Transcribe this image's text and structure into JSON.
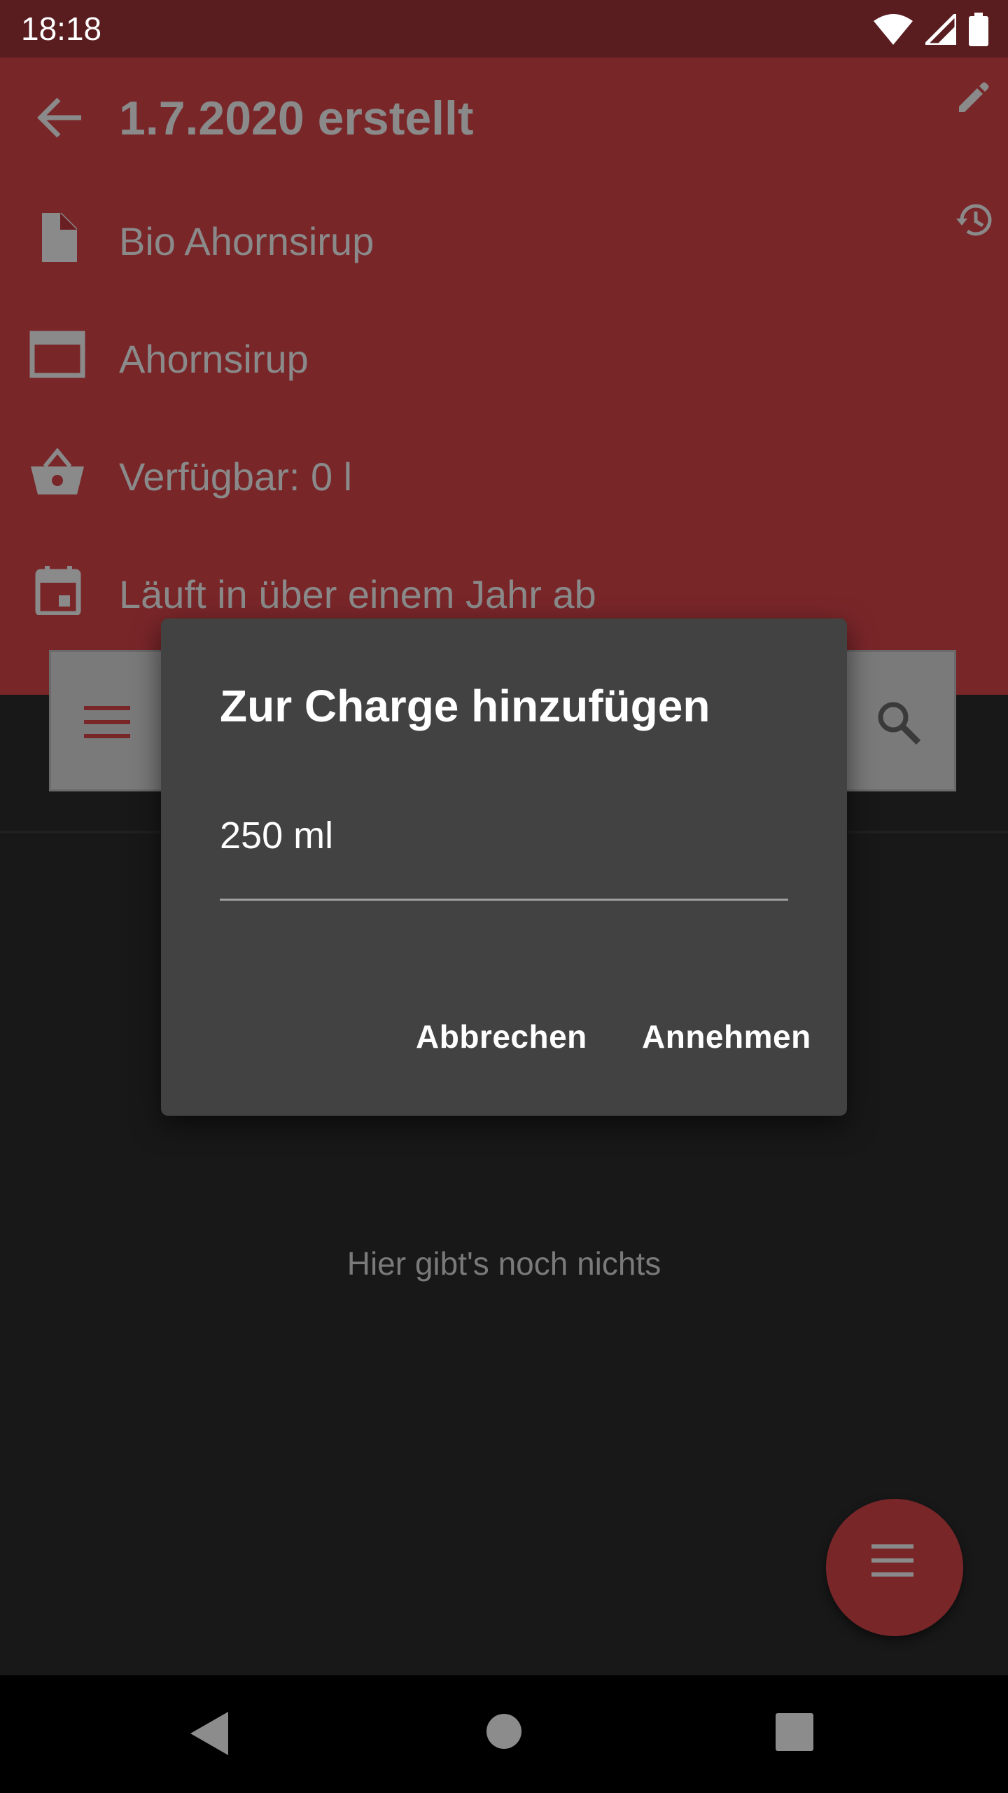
{
  "status_bar": {
    "time": "18:18"
  },
  "toolbar": {
    "title": "1.7.2020 erstellt"
  },
  "details": {
    "product": "Bio Ahornsirup",
    "category": "Ahornsirup",
    "available": "Verfügbar: 0 l",
    "expiry": "Läuft in über einem Jahr ab"
  },
  "empty_state": {
    "text": "Hier gibt's noch nichts"
  },
  "dialog": {
    "title": "Zur Charge hinzufügen",
    "input_value": "250 ml",
    "cancel_label": "Abbrechen",
    "confirm_label": "Annehmen"
  },
  "colors": {
    "header": "#792629",
    "status_bar": "#591c1f",
    "dialog_bg": "#424242",
    "background": "#181818"
  }
}
